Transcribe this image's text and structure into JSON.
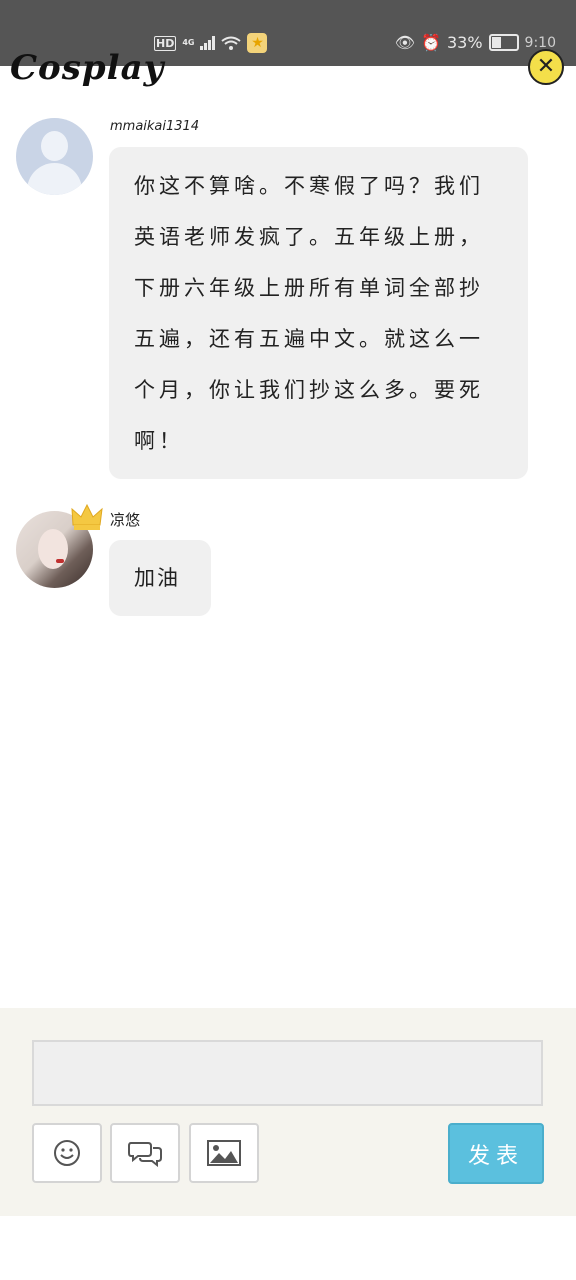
{
  "status_bar": {
    "network_badge": "HD",
    "network_type": "4G",
    "battery_percent": "33%",
    "time": "9:10"
  },
  "header": {
    "title": "Cosplay",
    "close_icon": "close-icon"
  },
  "messages": [
    {
      "username": "mmaikai1314",
      "text": "你这不算啥。不寒假了吗？我们英语老师发疯了。五年级上册，下册六年级上册所有单词全部抄五遍，还有五遍中文。就这么一个月，你让我们抄这么多。要死啊！"
    },
    {
      "username": "凉悠",
      "text": "加油"
    }
  ],
  "composer": {
    "input_value": "",
    "submit_label": "发表",
    "tools": [
      "emoji-icon",
      "chat-bubbles-icon",
      "image-icon"
    ]
  },
  "colors": {
    "status_bar": "#555555",
    "bubble": "#f0f0f0",
    "submit": "#5bc0de",
    "close": "#f4df4a"
  }
}
